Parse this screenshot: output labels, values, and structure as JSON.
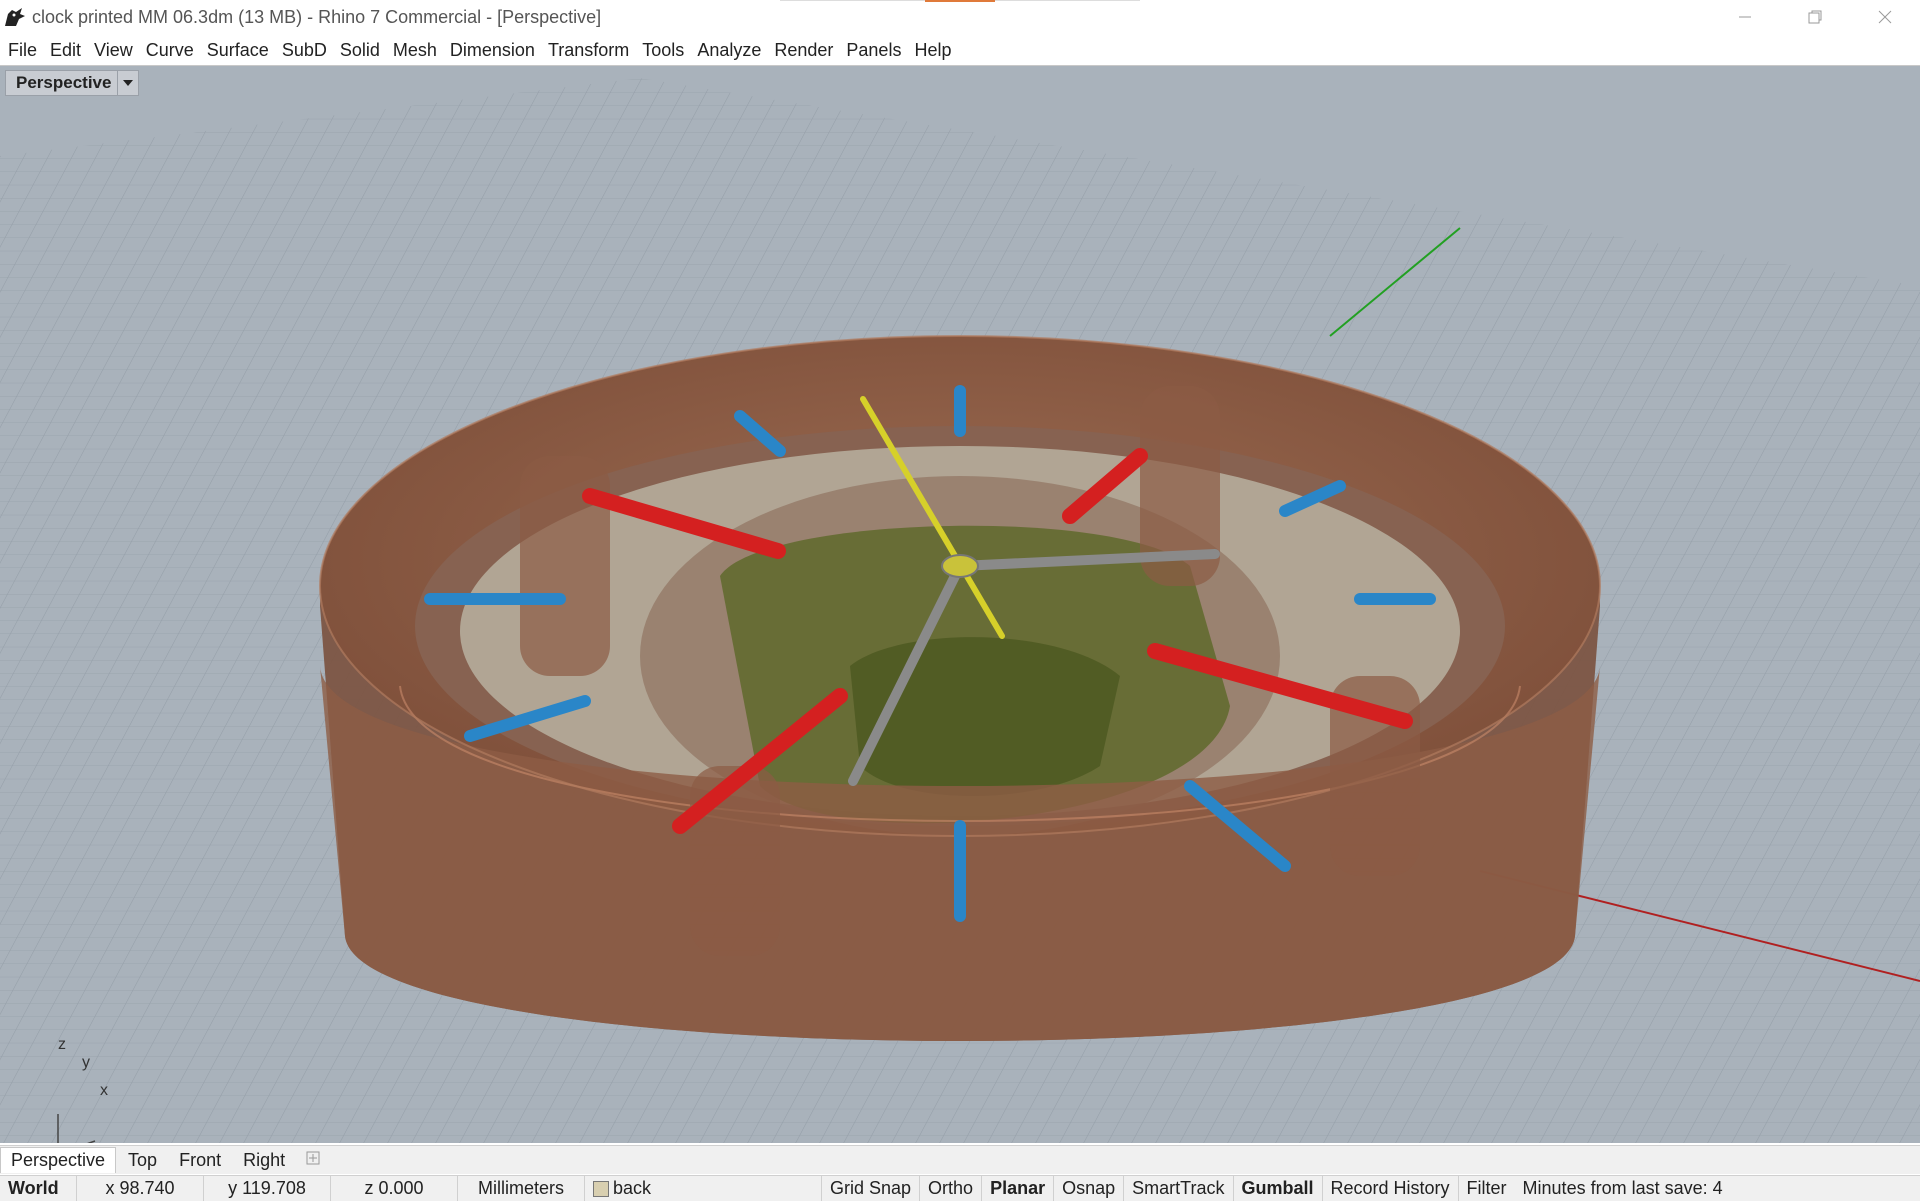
{
  "window": {
    "title": "clock printed MM 06.3dm (13 MB) - Rhino 7 Commercial - [Perspective]"
  },
  "menu": [
    "File",
    "Edit",
    "View",
    "Curve",
    "Surface",
    "SubD",
    "Solid",
    "Mesh",
    "Dimension",
    "Transform",
    "Tools",
    "Analyze",
    "Render",
    "Panels",
    "Help"
  ],
  "viewport": {
    "label": "Perspective",
    "axis_labels": {
      "z": "z",
      "y": "y",
      "x": "x"
    },
    "colors": {
      "background": "#a7b0b9",
      "grid": "#8e98a2",
      "model": "#8a5a43",
      "red_pins": "#d42020",
      "blue_pins": "#2a86c8",
      "green_part": "#5f6a2c",
      "yellow_hand": "#d6d02a",
      "x_axis": "#b02020",
      "y_axis": "#20a020"
    }
  },
  "viewport_tabs": [
    "Perspective",
    "Top",
    "Front",
    "Right"
  ],
  "status": {
    "cplane": "World",
    "x": "x 98.740",
    "y": "y 119.708",
    "z": "z 0.000",
    "units": "Millimeters",
    "layer": "back",
    "toggles": [
      "Grid Snap",
      "Ortho",
      "Planar",
      "Osnap",
      "SmartTrack",
      "Gumball",
      "Record History",
      "Filter"
    ],
    "active_toggles": [
      "Planar",
      "Gumball"
    ],
    "save_info": "Minutes from last save: 4"
  }
}
